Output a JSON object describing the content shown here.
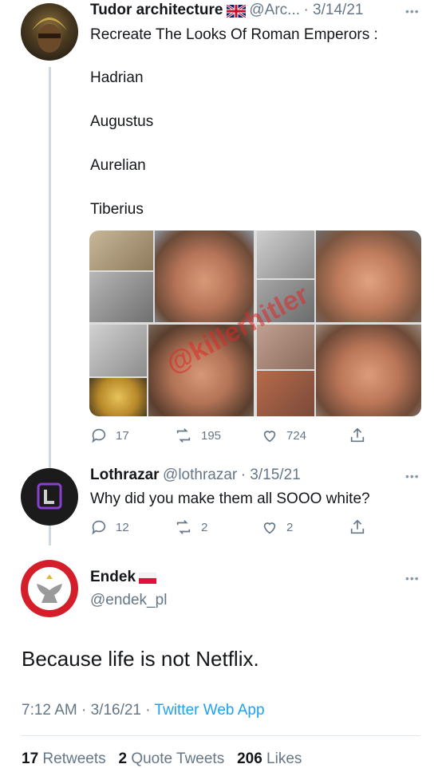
{
  "tweet1": {
    "display_name": "Tudor architecture",
    "handle": "@Arc...",
    "date": "· 3/14/21",
    "text_line": "Recreate The Looks Of Roman Emperors :",
    "emperors": [
      "Hadrian",
      "Augustus",
      "Aurelian",
      "Tiberius"
    ],
    "watermark": "@killerhitler",
    "replies": "17",
    "retweets": "195",
    "likes": "724"
  },
  "tweet2": {
    "display_name": "Lothrazar",
    "handle": "@lothrazar",
    "date": "· 3/15/21",
    "text": "Why did you make them all SOOO white?",
    "replies": "12",
    "retweets": "2",
    "likes": "2"
  },
  "tweet3": {
    "display_name": "Endek",
    "handle": "@endek_pl",
    "text": "Because life is not Netflix.",
    "timestamp": "7:12 AM · 3/16/21 · ",
    "source": "Twitter Web App",
    "retweets_count": "17",
    "retweets_label": "Retweets",
    "quotes_count": "2",
    "quotes_label": "Quote Tweets",
    "likes_count": "206",
    "likes_label": "Likes"
  },
  "colors": {
    "link": "#1da1f2",
    "secondary": "#657786",
    "divider": "#e1e8ed"
  }
}
